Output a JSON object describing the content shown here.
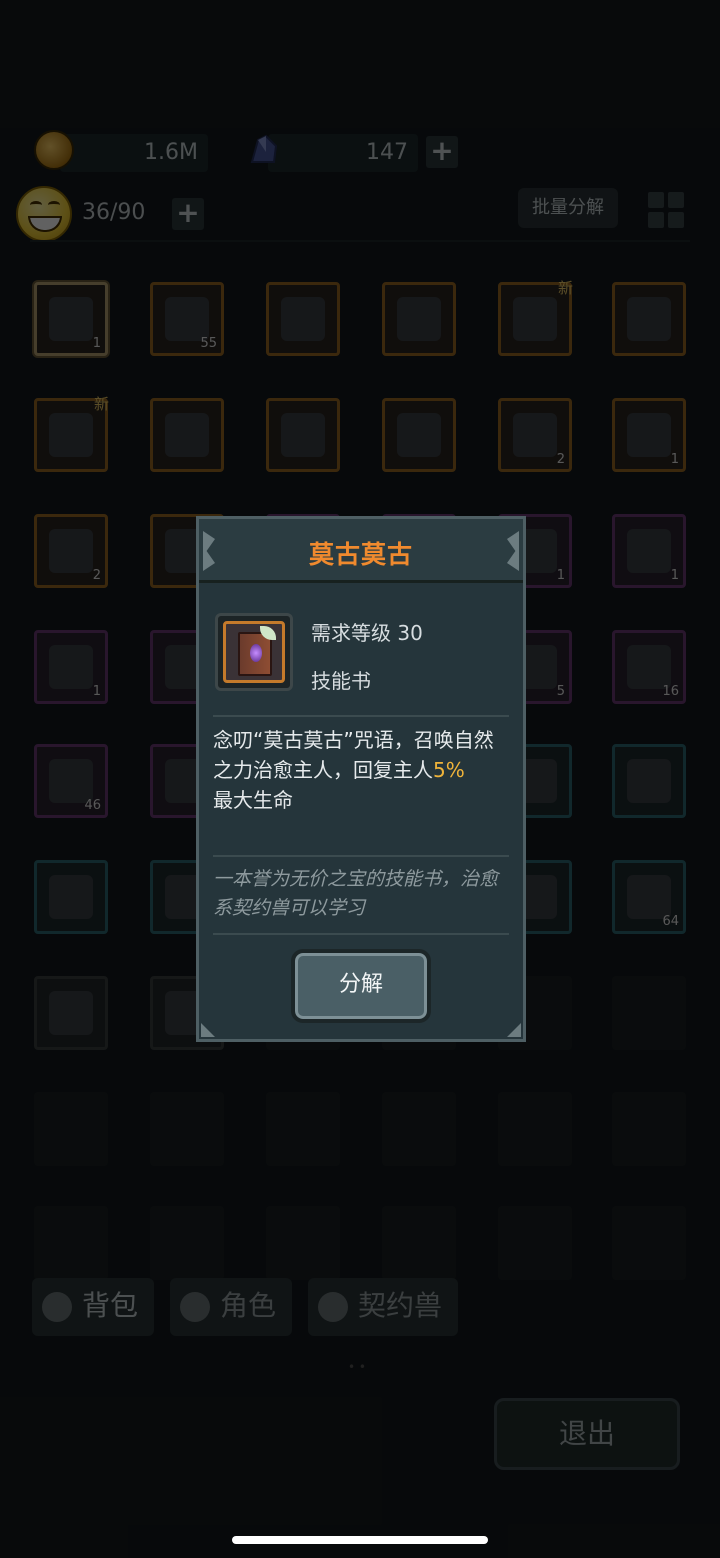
{
  "header": {
    "gold": "1.6M",
    "crystals": "147",
    "capacity": "36/90",
    "batch_decompose": "批量分解"
  },
  "grid": {
    "row1": [
      {
        "count": "1",
        "rarity": "orange",
        "selected": true
      },
      {
        "count": "55",
        "rarity": "orange"
      },
      {
        "count": "",
        "rarity": "orange"
      },
      {
        "count": "",
        "rarity": "orange"
      },
      {
        "count": "",
        "rarity": "orange",
        "new": "新"
      },
      {
        "count": "",
        "rarity": "orange"
      }
    ],
    "row2": [
      {
        "count": "",
        "rarity": "orange",
        "new": "新"
      },
      {
        "count": "",
        "rarity": "orange"
      },
      {
        "count": "",
        "rarity": "orange"
      },
      {
        "count": "",
        "rarity": "orange"
      },
      {
        "count": "2",
        "rarity": "orange"
      },
      {
        "count": "1",
        "rarity": "orange"
      }
    ],
    "row3": [
      {
        "count": "2",
        "rarity": "orange"
      },
      {
        "count": "",
        "rarity": "orange"
      },
      {
        "count": "",
        "rarity": "purple"
      },
      {
        "count": "",
        "rarity": "purple"
      },
      {
        "count": "1",
        "rarity": "purple"
      },
      {
        "count": "1",
        "rarity": "purple"
      }
    ],
    "row4": [
      {
        "count": "1",
        "rarity": "purple"
      },
      {
        "count": "",
        "rarity": "purple"
      },
      {
        "count": "",
        "rarity": "purple"
      },
      {
        "count": "",
        "rarity": "purple"
      },
      {
        "count": "5",
        "rarity": "purple"
      },
      {
        "count": "16",
        "rarity": "purple"
      }
    ],
    "row5": [
      {
        "count": "46",
        "rarity": "purple"
      },
      {
        "count": "",
        "rarity": "purple"
      },
      {
        "count": "",
        "rarity": "teal"
      },
      {
        "count": "",
        "rarity": "teal"
      },
      {
        "count": "",
        "rarity": "teal"
      },
      {
        "count": "",
        "rarity": "teal"
      }
    ],
    "row6": [
      {
        "count": "",
        "rarity": "teal"
      },
      {
        "count": "",
        "rarity": "teal"
      },
      {
        "count": "",
        "rarity": "teal"
      },
      {
        "count": "",
        "rarity": "teal"
      },
      {
        "count": "",
        "rarity": "teal"
      },
      {
        "count": "64",
        "rarity": "teal"
      }
    ],
    "row7": [
      {
        "count": "",
        "rarity": "gray"
      },
      {
        "count": "",
        "rarity": "gray"
      }
    ]
  },
  "tabs": {
    "bag": "背包",
    "role": "角色",
    "pet": "契约兽"
  },
  "exit": "退出",
  "modal": {
    "title": "莫古莫古",
    "required_level": "需求等级 30",
    "item_type": "技能书",
    "description_pre": "念叨“莫古莫古”咒语，召唤自然之力治愈主人，回复主人",
    "description_highlight": "5%",
    "description_post": "最大生命",
    "flavor": "一本誉为无价之宝的技能书，治愈系契约兽可以学习",
    "decompose_button": "分解"
  },
  "colors": {
    "title_orange": "#f08a2e",
    "highlight_gold": "#f0b43a",
    "rarity_orange": "#9b6a23",
    "rarity_purple": "#6c3b78",
    "rarity_teal": "#2f6a73"
  }
}
